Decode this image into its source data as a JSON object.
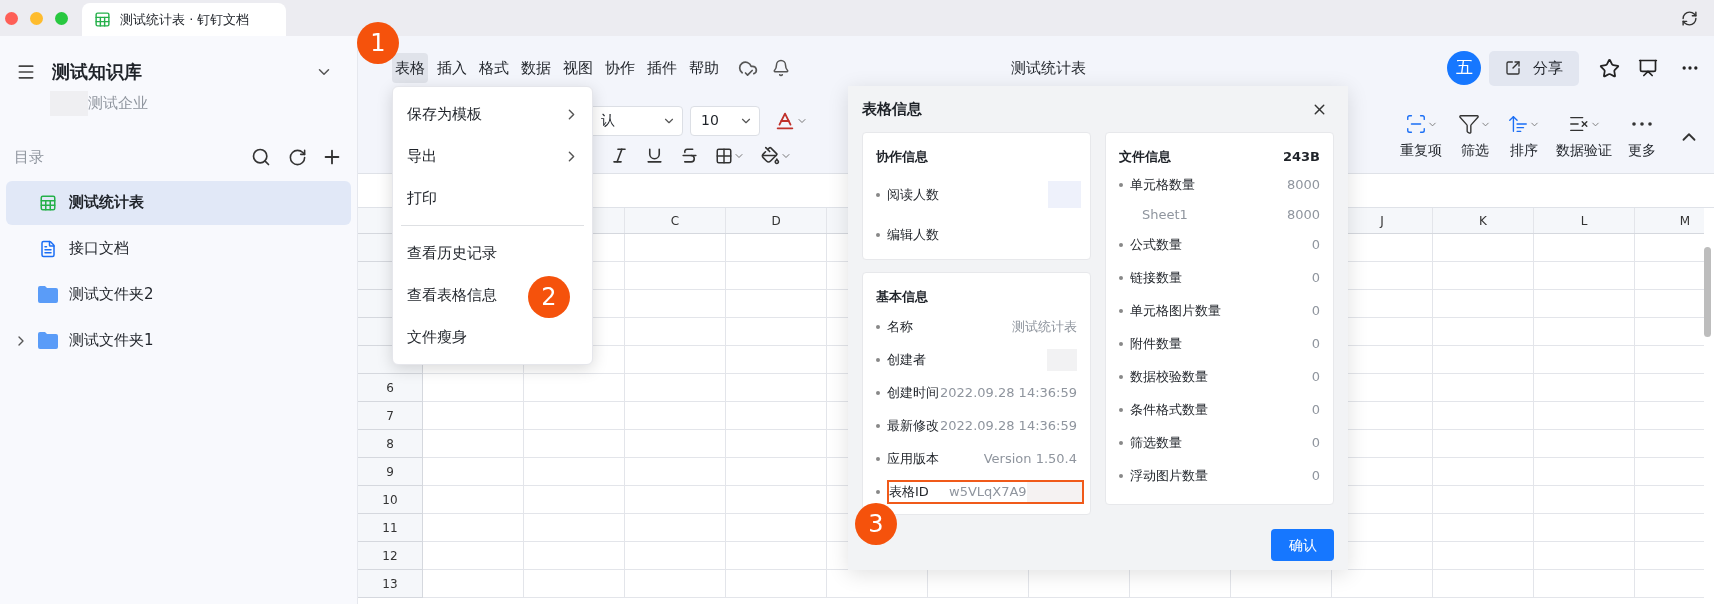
{
  "window": {
    "tab_title": "测试统计表 · 钉钉文档"
  },
  "sidebar": {
    "space_name": "测试知识库",
    "org_name": "测试企业",
    "section_label": "目录",
    "items": [
      {
        "label": "测试统计表",
        "kind": "sheet",
        "selected": true,
        "expandable": false
      },
      {
        "label": "接口文档",
        "kind": "doc",
        "selected": false,
        "expandable": false
      },
      {
        "label": "测试文件夹2",
        "kind": "folder",
        "selected": false,
        "expandable": false
      },
      {
        "label": "测试文件夹1",
        "kind": "folder",
        "selected": false,
        "expandable": true
      }
    ]
  },
  "menu_bar": {
    "items": [
      {
        "label": "表格",
        "selected": true
      },
      {
        "label": "插入",
        "selected": false
      },
      {
        "label": "格式",
        "selected": false
      },
      {
        "label": "数据",
        "selected": false
      },
      {
        "label": "视图",
        "selected": false
      },
      {
        "label": "协作",
        "selected": false
      },
      {
        "label": "插件",
        "selected": false
      },
      {
        "label": "帮助",
        "selected": false
      }
    ]
  },
  "doc_title": "测试统计表",
  "avatar": "五",
  "share_button": "分享",
  "toolbar": {
    "font": "认",
    "font_size": "10",
    "tools": [
      {
        "label": "重复项",
        "kind": "duplicates"
      },
      {
        "label": "筛选",
        "kind": "filter"
      },
      {
        "label": "排序",
        "kind": "sort"
      },
      {
        "label": "数据验证",
        "kind": "validate"
      },
      {
        "label": "更多",
        "kind": "more"
      }
    ]
  },
  "grid": {
    "columns": [
      "C",
      "D",
      "J",
      "K",
      "L",
      "M"
    ],
    "row_numbers": [
      "6",
      "7",
      "8",
      "9",
      "10",
      "11",
      "12",
      "13"
    ]
  },
  "dropdown": {
    "items": [
      {
        "label": "保存为模板",
        "kind": "submenu"
      },
      {
        "label": "导出",
        "kind": "submenu"
      },
      {
        "label": "打印",
        "kind": "item"
      },
      {
        "kind": "divider"
      },
      {
        "label": "查看历史记录",
        "kind": "item"
      },
      {
        "label": "查看表格信息",
        "kind": "item"
      },
      {
        "label": "文件瘦身",
        "kind": "item"
      }
    ]
  },
  "dialog": {
    "title": "表格信息",
    "collab": {
      "title": "协作信息",
      "rows": [
        {
          "label": "阅读人数",
          "kind": "redacted"
        },
        {
          "label": "编辑人数",
          "kind": "empty"
        }
      ]
    },
    "basic": {
      "title": "基本信息",
      "rows": [
        {
          "label": "名称",
          "value": "测试统计表",
          "kind": "text"
        },
        {
          "label": "创建者",
          "kind": "redacted"
        },
        {
          "label": "创建时间",
          "value": "2022.09.28 14:36:59",
          "kind": "text"
        },
        {
          "label": "最新修改",
          "value": "2022.09.28 14:36:59",
          "kind": "text"
        },
        {
          "label": "应用版本",
          "value": "Version 1.50.4",
          "kind": "text"
        },
        {
          "label": "表格ID",
          "value": "w5VLqX7A9",
          "kind": "id",
          "highlighted": true
        }
      ]
    },
    "file": {
      "title": "文件信息",
      "size": "243B",
      "rows": [
        {
          "label": "单元格数量",
          "value": "8000",
          "kind": "main"
        },
        {
          "label": "Sheet1",
          "value": "8000",
          "kind": "sub"
        },
        {
          "label": "公式数量",
          "value": "0",
          "kind": "main"
        },
        {
          "label": "链接数量",
          "value": "0",
          "kind": "main"
        },
        {
          "label": "单元格图片数量",
          "value": "0",
          "kind": "main"
        },
        {
          "label": "附件数量",
          "value": "0",
          "kind": "main"
        },
        {
          "label": "数据校验数量",
          "value": "0",
          "kind": "main"
        },
        {
          "label": "条件格式数量",
          "value": "0",
          "kind": "main"
        },
        {
          "label": "筛选数量",
          "value": "0",
          "kind": "main"
        },
        {
          "label": "浮动图片数量",
          "value": "0",
          "kind": "main"
        }
      ]
    },
    "confirm_button": "确认"
  },
  "annotations": [
    {
      "number": "1"
    },
    {
      "number": "2"
    },
    {
      "number": "3"
    }
  ]
}
